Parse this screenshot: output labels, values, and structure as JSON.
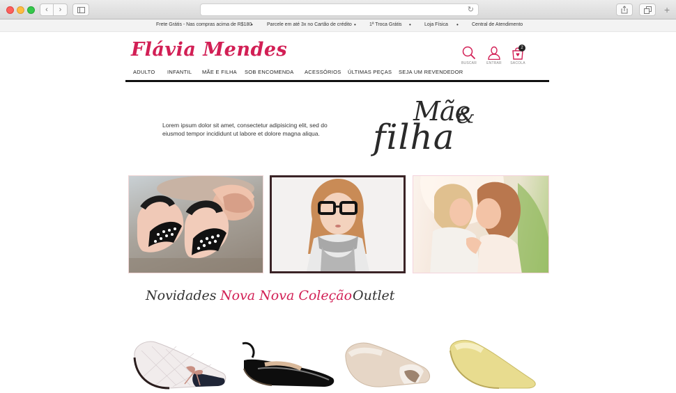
{
  "browser": {
    "back_glyph": "‹",
    "forward_glyph": "›",
    "reload_glyph": "↻",
    "new_tab_glyph": "+"
  },
  "infobar": {
    "items": [
      "Frete Grátis - Nas compras acima de R$180",
      "Parcele em até 3x no Cartão de crédito",
      "1ª Troca Grátis",
      "Loja Física",
      "Central de Atendimento"
    ],
    "bullet": "•"
  },
  "header": {
    "logo": "Flávia Mendes",
    "icons": [
      {
        "name": "search-icon",
        "label": "BUSCAR"
      },
      {
        "name": "user-icon",
        "label": "ENTRAR"
      },
      {
        "name": "bag-icon",
        "label": "SACOLA",
        "badge": "2"
      }
    ],
    "menu": [
      "ADULTO",
      "INFANTIL",
      "MÃE E FILHA",
      "SOB  ENCOMENDA",
      "ACESSÓRIOS",
      "ÚLTIMAS PEÇAS",
      "SEJA UM REVENDEDOR"
    ]
  },
  "hero": {
    "text": "Lorem ipsum dolor sit amet, consectetur adipisicing elit, sed do eiusmod tempor incididunt ut labore et dolore magna aliqua.",
    "title_line1": "Mãe",
    "title_amp": "&",
    "title_line2": "filha"
  },
  "categories": [
    "Novidades",
    "Nova Nova Coleção",
    "Outlet"
  ],
  "colors": {
    "brand": "#d21f55",
    "text": "#222222",
    "frame_dark": "#3a2326"
  },
  "products": [
    {
      "name": "shoe-white-quilted-bow",
      "icon": "flat-shoe"
    },
    {
      "name": "shoe-black-patent-slingback",
      "icon": "flat-shoe"
    },
    {
      "name": "shoe-nude-flat",
      "icon": "flat-shoe"
    },
    {
      "name": "shoe-yellow-pointed-flat",
      "icon": "flat-shoe"
    }
  ]
}
